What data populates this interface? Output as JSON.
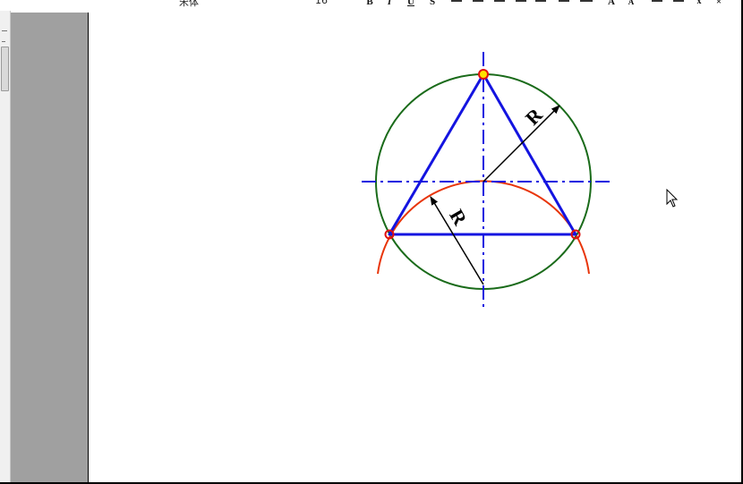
{
  "toolbar": {
    "font_name": "宋体",
    "font_size": "16",
    "bold_label": "B",
    "italic_label": "I",
    "underline_label": "U",
    "grow_font_label": "A",
    "shrink_font_label": "A",
    "close_label": "×"
  },
  "drawing": {
    "radius_label_top": "R",
    "radius_label_bottom": "R",
    "colors": {
      "green_circle": "#1a6b1a",
      "orange_arc": "#e8350a",
      "triangle": "#1414e0",
      "center_lines": "#1414e0",
      "radius_lines": "#000000",
      "vertex_marker": "#e01010"
    }
  }
}
